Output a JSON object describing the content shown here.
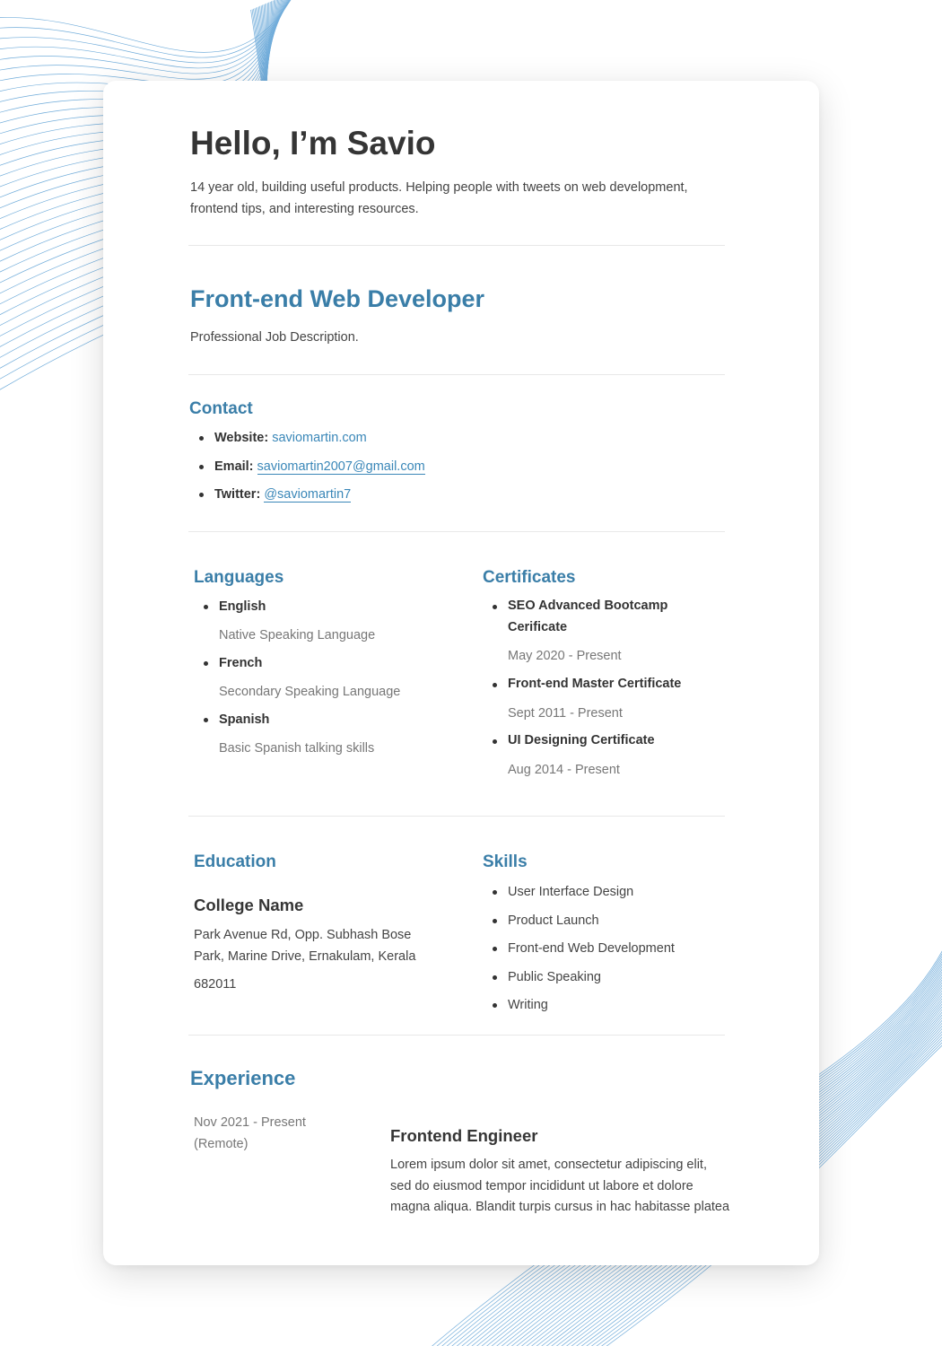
{
  "header": {
    "greeting": "Hello, I’m Savio",
    "intro": "14 year old, building useful products. Helping people with tweets on web development, frontend tips, and interesting resources."
  },
  "profession": {
    "title": "Front-end Web Developer",
    "description": "Professional Job Description."
  },
  "contact": {
    "title": "Contact",
    "items": [
      {
        "key": "Website:",
        "value": "saviomartin.com"
      },
      {
        "key": "Email:",
        "value": "saviomartin2007@gmail.com"
      },
      {
        "key": "Twitter:",
        "value": "@saviomartin7"
      }
    ]
  },
  "languages": {
    "title": "Languages",
    "items": [
      {
        "name": "English",
        "desc": "Native Speaking Language"
      },
      {
        "name": "French",
        "desc": "Secondary Speaking Language"
      },
      {
        "name": "Spanish",
        "desc": "Basic Spanish talking skills"
      }
    ]
  },
  "certificates": {
    "title": "Certificates",
    "items": [
      {
        "name": "SEO Advanced Bootcamp Cerificate",
        "date": "May 2020 - Present"
      },
      {
        "name": "Front-end Master Certificate",
        "date": "Sept 2011 - Present"
      },
      {
        "name": "UI Designing Certificate",
        "date": "Aug 2014 - Present"
      }
    ]
  },
  "education": {
    "title": "Education",
    "college": "College Name",
    "address": "Park Avenue Rd, Opp. Subhash Bose Park, Marine Drive, Ernakulam, Kerala",
    "pin": "682011"
  },
  "skills": {
    "title": "Skills",
    "items": [
      "User Interface Design",
      "Product Launch",
      "Front-end Web Development",
      "Public Speaking",
      "Writing"
    ]
  },
  "experience": {
    "title": "Experience",
    "date": "Nov 2021 - Present (Remote)",
    "job_title": "Frontend Engineer",
    "job_desc": "Lorem ipsum dolor sit amet, consectetur adipiscing elit, sed do eiusmod tempor incididunt ut labore et dolore magna aliqua. Blandit turpis cursus in hac habitasse platea"
  },
  "colors": {
    "accent": "#3a7ea8",
    "link": "#3a87b8",
    "text": "#353535",
    "muted": "#777777",
    "background_lines": "#5a9fd4"
  }
}
